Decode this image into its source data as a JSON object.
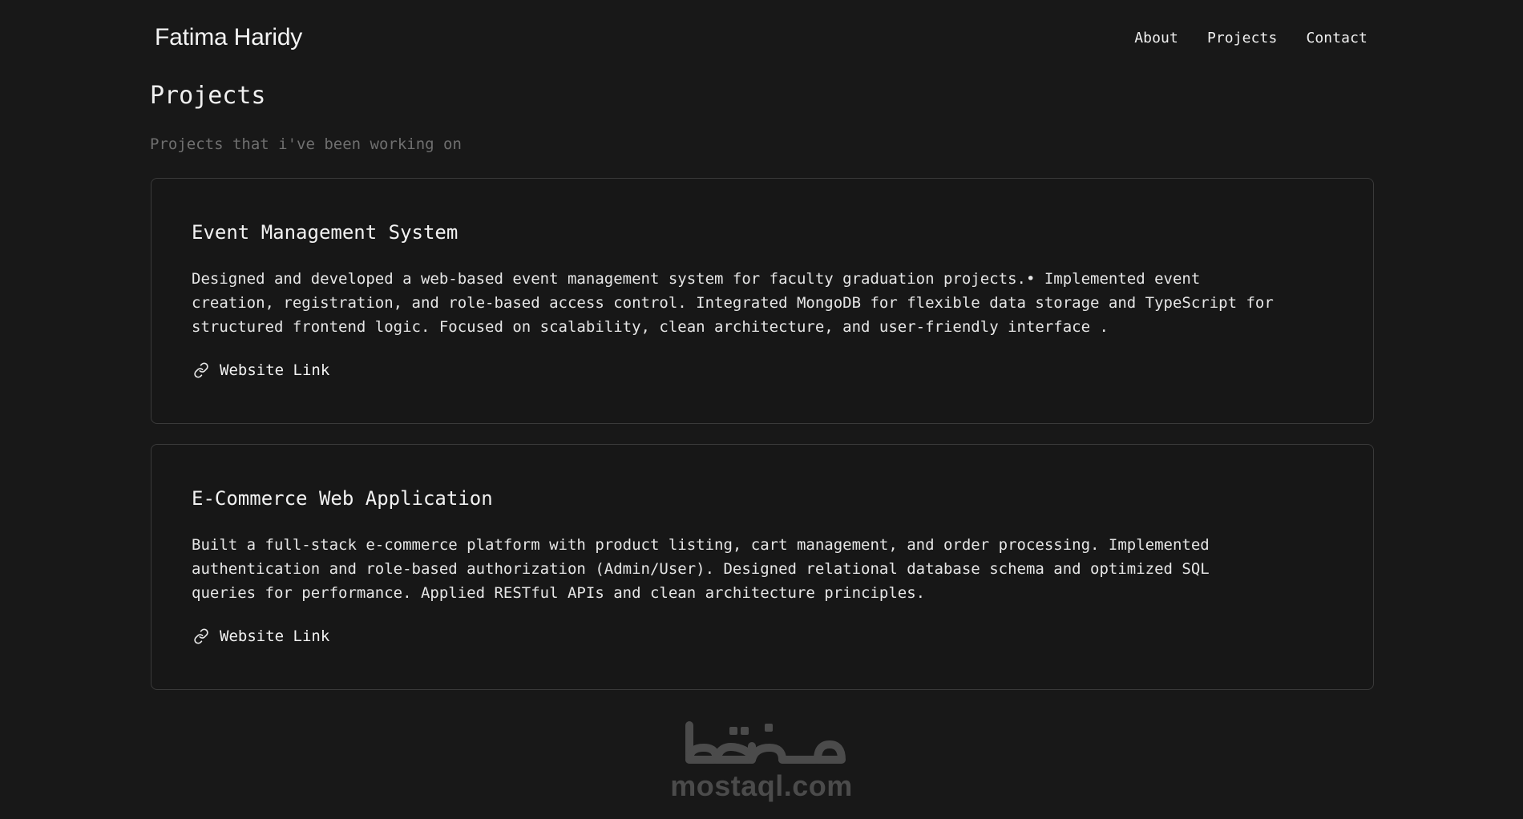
{
  "header": {
    "brand": "Fatima Haridy",
    "nav": [
      {
        "label": "About"
      },
      {
        "label": "Projects"
      },
      {
        "label": "Contact"
      }
    ]
  },
  "page": {
    "title": "Projects",
    "subtitle": "Projects that i've been working on"
  },
  "projects": [
    {
      "title": "Event Management System",
      "description": "Designed and developed a web-based event management system for faculty graduation projects.• Implemented event\ncreation, registration, and role-based access control. Integrated MongoDB for flexible data storage and TypeScript for\nstructured frontend logic. Focused on scalability, clean architecture, and user-friendly interface .",
      "link_label": "Website Link",
      "link_icon": "link-icon"
    },
    {
      "title": "E-Commerce Web Application",
      "description": "Built a full-stack e-commerce platform with product listing, cart management, and order processing. Implemented\nauthentication and role-based authorization (Admin/User). Designed relational database schema and optimized SQL\nqueries for performance. Applied RESTful APIs and clean architecture principles.",
      "link_label": "Website Link",
      "link_icon": "link-icon"
    }
  ],
  "watermark": {
    "logo_text": "مستقل",
    "text": "mostaql.com"
  },
  "colors": {
    "background": "#181818",
    "card_border": "#3a3a3a",
    "text": "#f2f2f2",
    "muted": "#6f6f6f",
    "watermark": "#4b4b4b"
  }
}
